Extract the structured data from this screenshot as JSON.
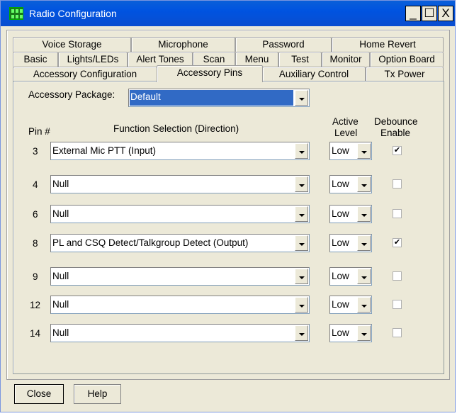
{
  "window": {
    "title": "Radio Configuration",
    "minimize": "_",
    "maximize": "☐",
    "close": "X"
  },
  "tabs": {
    "row1": [
      "Voice Storage",
      "Microphone",
      "Password",
      "Home Revert"
    ],
    "row2": [
      "Basic",
      "Lights/LEDs",
      "Alert Tones",
      "Scan",
      "Menu",
      "Test",
      "Monitor",
      "Option Board"
    ],
    "row3": [
      "Accessory Configuration",
      "Accessory Pins",
      "Auxiliary Control",
      "Tx Power"
    ],
    "selected": "Accessory Pins"
  },
  "package": {
    "label": "Accessory Package:",
    "value": "Default"
  },
  "headers": {
    "pin": "Pin #",
    "function": "Function Selection (Direction)",
    "active1": "Active",
    "active2": "Level",
    "debounce1": "Debounce",
    "debounce2": "Enable"
  },
  "pins": [
    {
      "pin": "3",
      "function": "External Mic PTT (Input)",
      "level": "Low",
      "debounce": true
    },
    {
      "pin": "4",
      "function": "Null",
      "level": "Low",
      "debounce": false
    },
    {
      "pin": "6",
      "function": "Null",
      "level": "Low",
      "debounce": false
    },
    {
      "pin": "8",
      "function": "PL and CSQ Detect/Talkgroup Detect (Output)",
      "level": "Low",
      "debounce": true
    },
    {
      "pin": "9",
      "function": "Null",
      "level": "Low",
      "debounce": false
    },
    {
      "pin": "12",
      "function": "Null",
      "level": "Low",
      "debounce": false
    },
    {
      "pin": "14",
      "function": "Null",
      "level": "Low",
      "debounce": false
    }
  ],
  "buttons": {
    "close": "Close",
    "help": "Help"
  }
}
